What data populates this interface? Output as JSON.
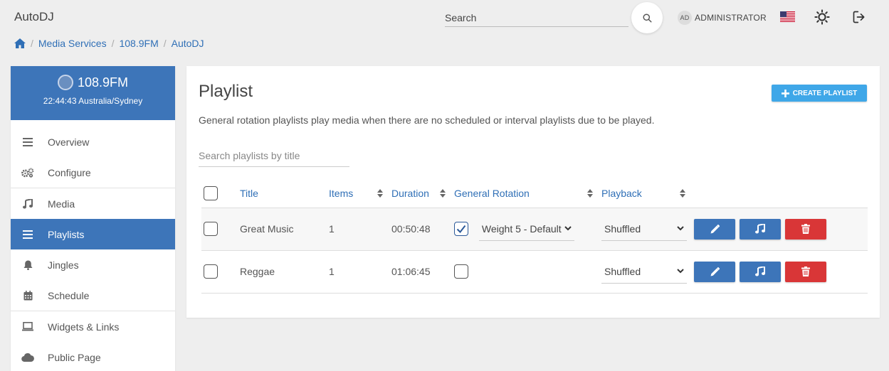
{
  "app": {
    "title": "AutoDJ"
  },
  "search": {
    "placeholder": "Search"
  },
  "user": {
    "initials": "AD",
    "name": "ADMINISTRATOR"
  },
  "breadcrumb": [
    "Media Services",
    "108.9FM",
    "AutoDJ"
  ],
  "station": {
    "name": "108.9FM",
    "time": "22:44:43 Australia/Sydney"
  },
  "nav": [
    {
      "label": "Overview",
      "icon": "menu-icon"
    },
    {
      "label": "Configure",
      "icon": "gears-icon"
    },
    {
      "label": "Media",
      "icon": "music-note-icon"
    },
    {
      "label": "Playlists",
      "icon": "list-icon",
      "active": true
    },
    {
      "label": "Jingles",
      "icon": "bell-icon"
    },
    {
      "label": "Schedule",
      "icon": "calendar-icon"
    },
    {
      "label": "Widgets & Links",
      "icon": "laptop-icon"
    },
    {
      "label": "Public Page",
      "icon": "cloud-icon"
    }
  ],
  "page": {
    "title": "Playlist",
    "create_label": "CREATE PLAYLIST",
    "description": "General rotation playlists play media when there are no scheduled or interval playlists due to be played.",
    "search_placeholder": "Search playlists by title"
  },
  "table": {
    "columns": [
      "Title",
      "Items",
      "Duration",
      "General Rotation",
      "Playback"
    ],
    "rows": [
      {
        "title": "Great Music",
        "items": "1",
        "duration": "00:50:48",
        "general_rotation": true,
        "weight": "Weight 5 - Default",
        "playback": "Shuffled"
      },
      {
        "title": "Reggae",
        "items": "1",
        "duration": "01:06:45",
        "general_rotation": false,
        "weight": "",
        "playback": "Shuffled"
      }
    ]
  },
  "colors": {
    "primary": "#3d75b9",
    "link": "#2f6fb6",
    "create": "#3fa7e8",
    "danger": "#d93637"
  }
}
